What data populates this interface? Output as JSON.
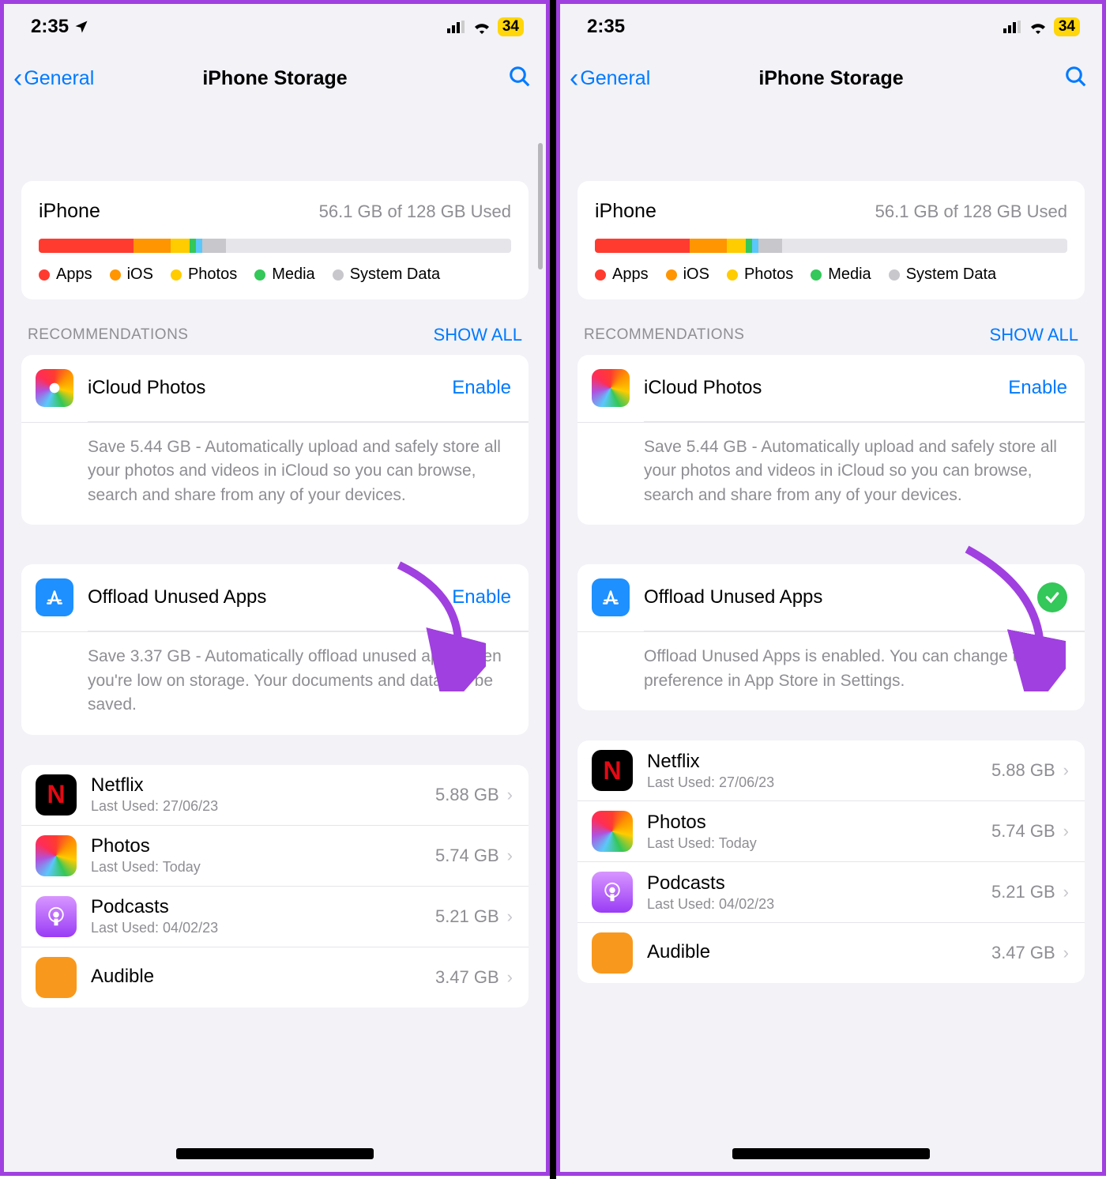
{
  "status": {
    "time_left": "2:35",
    "time_right": "2:35",
    "battery": "34"
  },
  "nav": {
    "back_label": "General",
    "title": "iPhone Storage"
  },
  "storage": {
    "device": "iPhone",
    "used_text": "56.1 GB of 128 GB Used",
    "segments": [
      {
        "color": "#ff3b30",
        "pct": 20
      },
      {
        "color": "#ff9500",
        "pct": 8
      },
      {
        "color": "#ffcc00",
        "pct": 4
      },
      {
        "color": "#34c759",
        "pct": 1.2
      },
      {
        "color": "#5ac8fa",
        "pct": 1.5
      },
      {
        "color": "#c7c7cc",
        "pct": 5
      }
    ],
    "legend": [
      {
        "label": "Apps",
        "color": "#ff3b30"
      },
      {
        "label": "iOS",
        "color": "#ff9500"
      },
      {
        "label": "Photos",
        "color": "#ffcc00"
      },
      {
        "label": "Media",
        "color": "#34c759"
      },
      {
        "label": "System Data",
        "color": "#c7c7cc"
      }
    ]
  },
  "recommendations": {
    "header": "RECOMMENDATIONS",
    "show_all": "SHOW ALL",
    "icloud": {
      "title": "iCloud Photos",
      "action": "Enable",
      "body": "Save 5.44 GB - Automatically upload and safely store all your photos and videos in iCloud so you can browse, search and share from any of your devices."
    },
    "offload_left": {
      "title": "Offload Unused Apps",
      "action": "Enable",
      "body": "Save 3.37 GB - Automatically offload unused apps when you're low on storage. Your documents and data will be saved."
    },
    "offload_right": {
      "title": "Offload Unused Apps",
      "body": "Offload Unused Apps is enabled. You can change this preference in App Store in Settings."
    }
  },
  "apps": [
    {
      "name": "Netflix",
      "sub": "Last Used: 27/06/23",
      "size": "5.88 GB",
      "icon": "netflix"
    },
    {
      "name": "Photos",
      "sub": "Last Used: Today",
      "size": "5.74 GB",
      "icon": "photos"
    },
    {
      "name": "Podcasts",
      "sub": "Last Used: 04/02/23",
      "size": "5.21 GB",
      "icon": "podcasts"
    },
    {
      "name": "Audible",
      "sub": "",
      "size": "3.47 GB",
      "icon": "audible"
    }
  ]
}
